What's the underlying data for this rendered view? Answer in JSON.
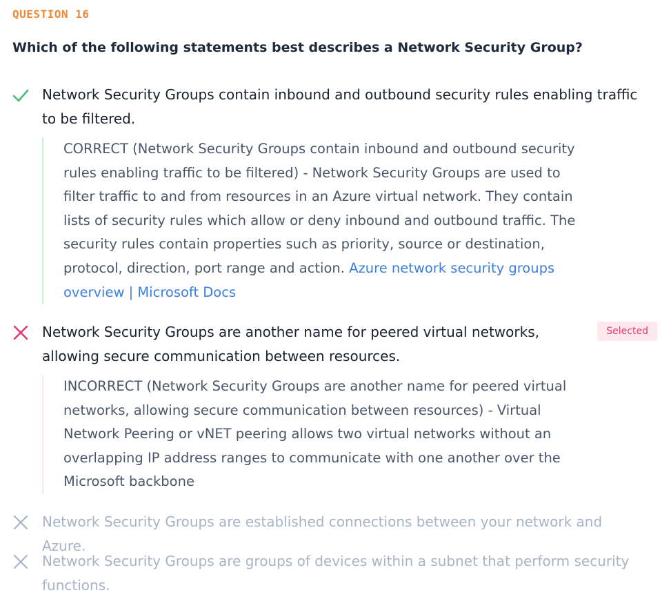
{
  "question": {
    "number_label": "QUESTION 16",
    "text": "Which of the following statements best describes a Network Security Group?"
  },
  "answers": [
    {
      "state": "correct",
      "text": "Network Security Groups contain inbound and outbound security rules enabling traffic to be filtered.",
      "explanation": "CORRECT (Network Security Groups contain inbound and outbound security rules enabling traffic to be filtered) - Network Security Groups are used to filter traffic to and from resources in an Azure virtual network. They contain lists of security rules which allow or deny inbound and outbound traffic. The security rules contain properties such as priority, source or destination, protocol, direction, port range and action.",
      "link_text": "Azure network security groups overview | Microsoft Docs"
    },
    {
      "state": "incorrect-selected",
      "text": "Network Security Groups are another name for peered virtual networks, allowing secure communication between resources.",
      "badge": "Selected",
      "explanation": "INCORRECT (Network Security Groups are another name for peered virtual networks, allowing secure communication between resources) - Virtual Network Peering or vNET peering allows two virtual networks without an overlapping IP address ranges to communicate with one another over the Microsoft backbone"
    },
    {
      "state": "incorrect",
      "text": "Network Security Groups are established connections between your network and Azure."
    },
    {
      "state": "incorrect",
      "text": "Network Security Groups are groups of devices within a subnet that perform security functions."
    }
  ],
  "colors": {
    "question_number": "#ed8936",
    "correct": "#48bb78",
    "incorrect": "#e53972",
    "muted": "#a8b4c6",
    "link": "#3d7fe0"
  },
  "icons": [
    "check-icon",
    "cross-icon"
  ]
}
